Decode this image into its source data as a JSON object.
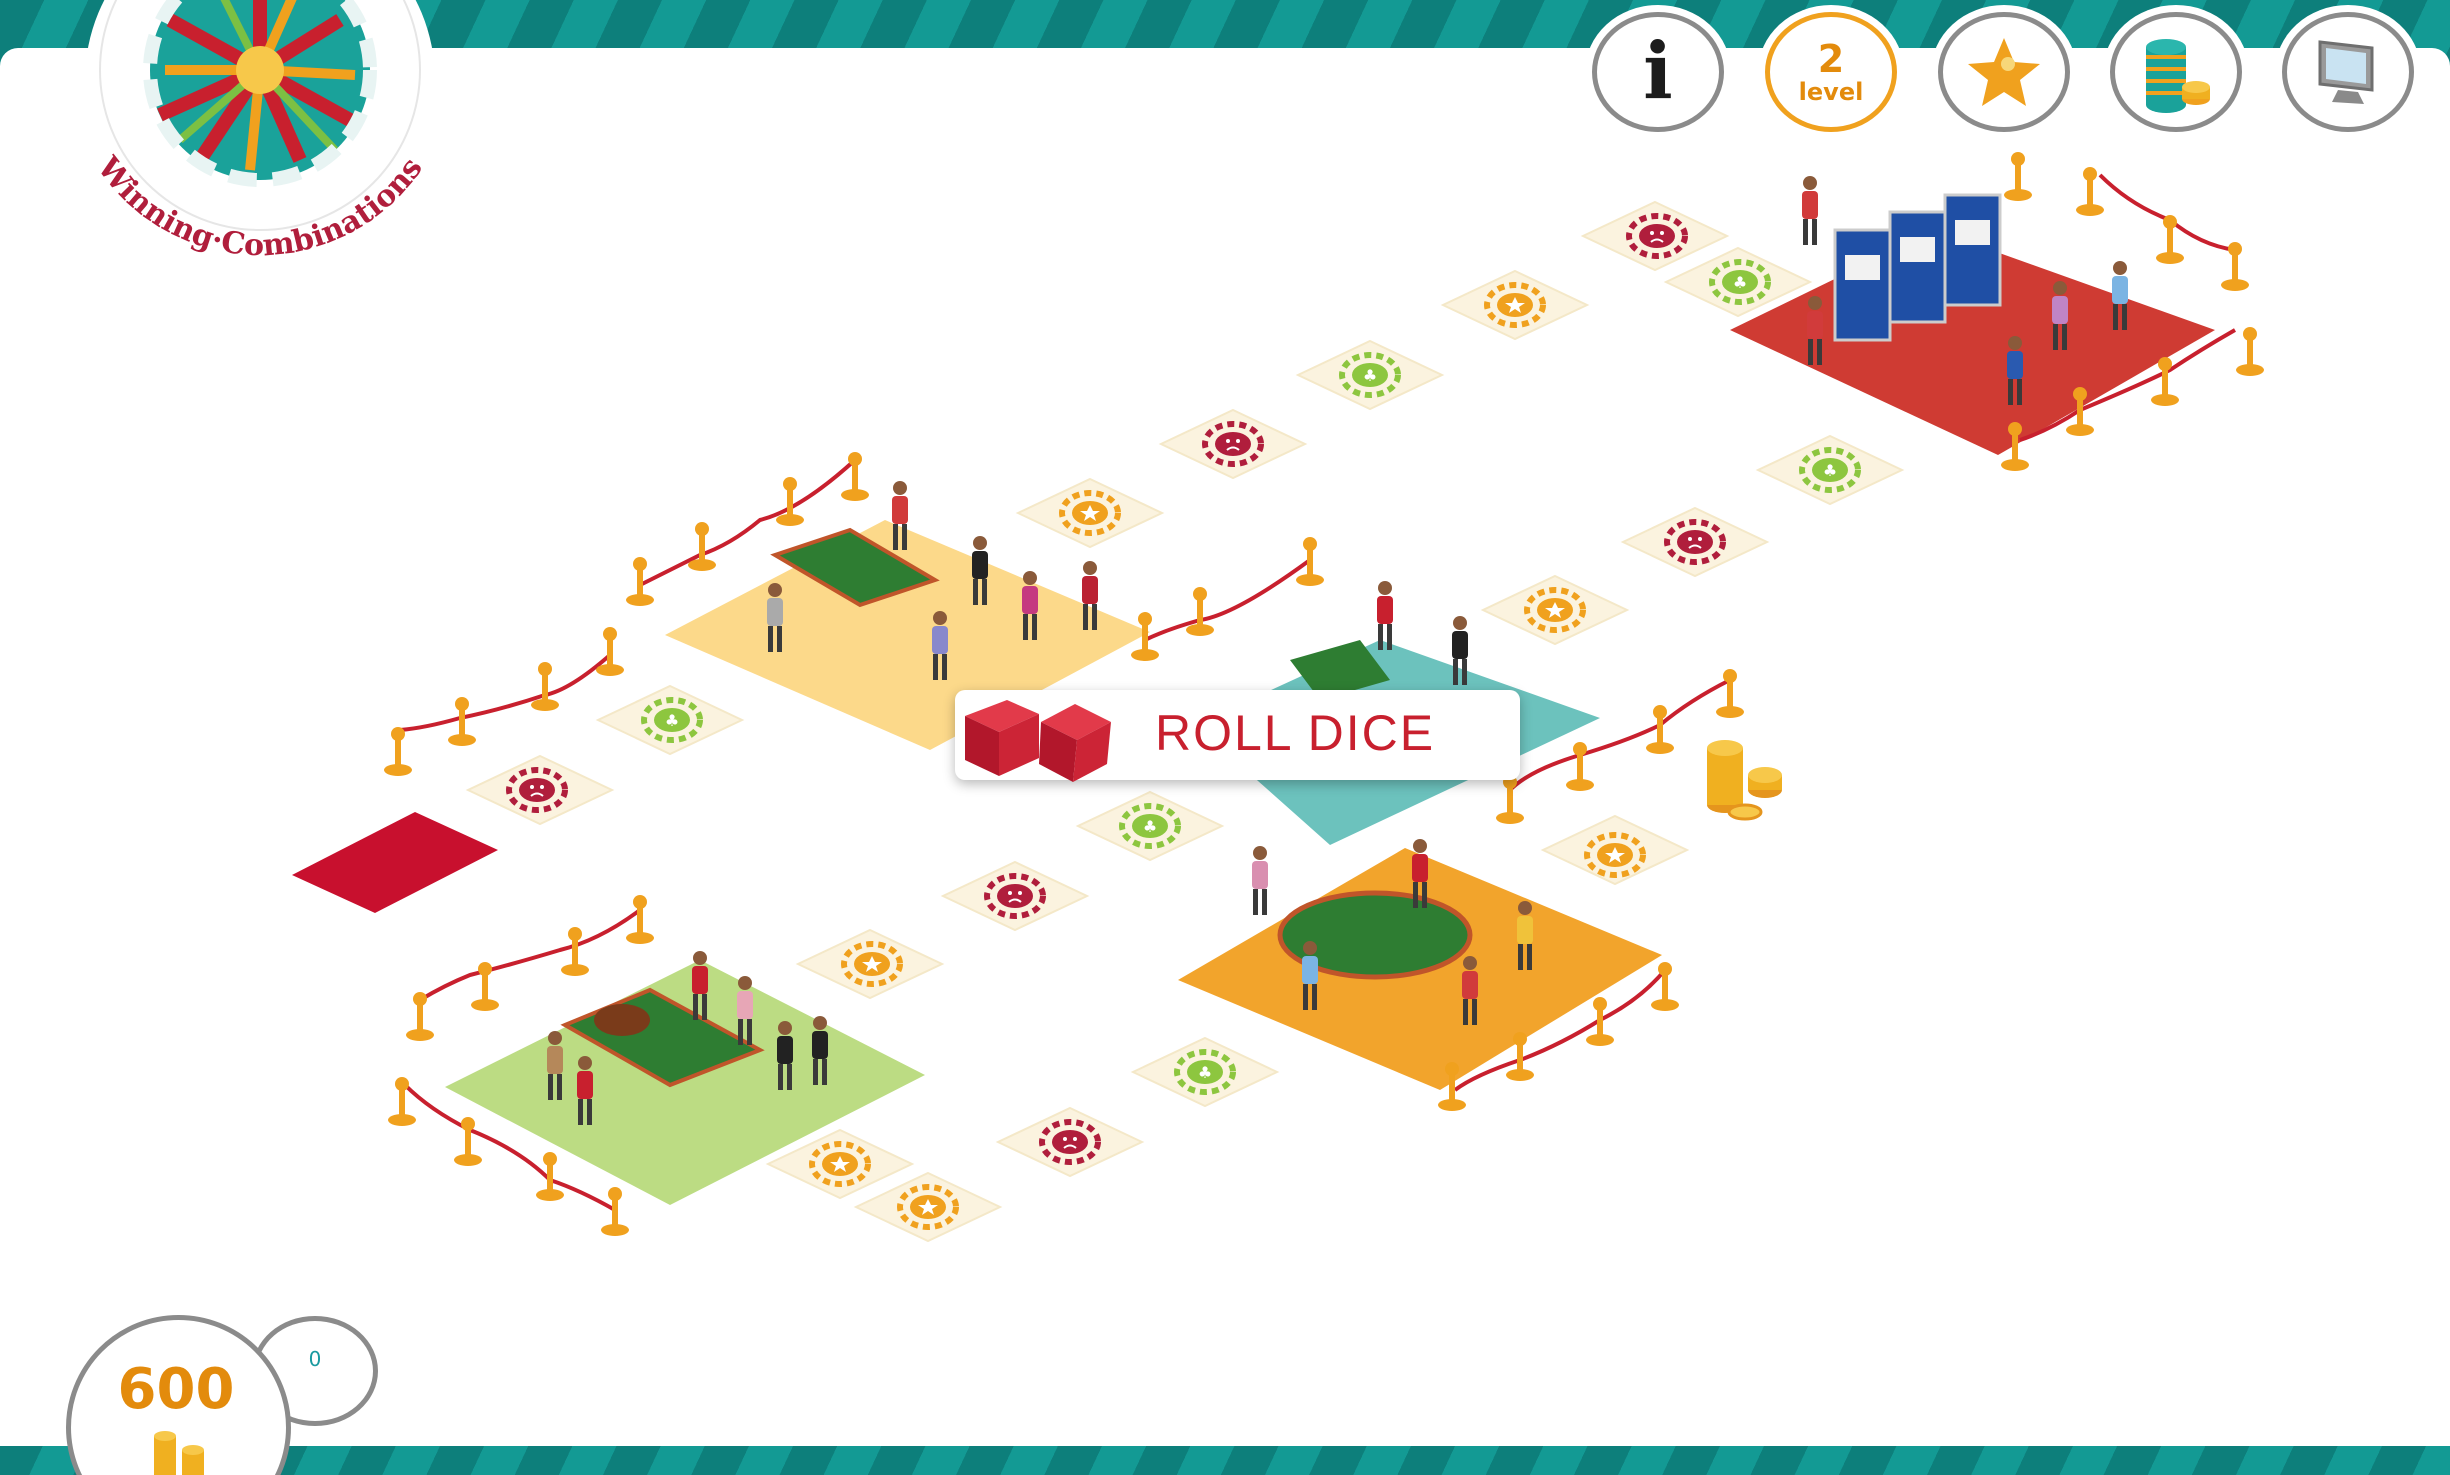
{
  "game": {
    "title": "Winning·Combinations",
    "level": {
      "number": "2",
      "label": "level"
    },
    "balance": "600",
    "bet": "0",
    "roll_dice_label": "ROLL DICE"
  },
  "toolbar": {
    "buttons": [
      {
        "name": "info",
        "icon": "info-icon"
      },
      {
        "name": "level",
        "icon": "level-badge"
      },
      {
        "name": "favorites",
        "icon": "star-icon"
      },
      {
        "name": "chips",
        "icon": "chip-stack-icon"
      },
      {
        "name": "display",
        "icon": "monitor-icon"
      }
    ]
  },
  "board": {
    "zones": [
      {
        "name": "roulette-zone",
        "color": "#fcd98a"
      },
      {
        "name": "blackjack-zone",
        "color": "#6cc2bd"
      },
      {
        "name": "slots-zone",
        "color": "#cf3b33"
      },
      {
        "name": "roulette-zone-2",
        "color": "#bcdc83"
      },
      {
        "name": "poker-zone",
        "color": "#f2a42c"
      },
      {
        "name": "start-tile",
        "color": "#c8102e"
      }
    ],
    "tile_types": [
      "star-chip",
      "green-chip",
      "sad-face-chip"
    ]
  },
  "colors": {
    "teal": "#108a86",
    "accent_red": "#c8202e",
    "gold": "#f0a11e",
    "rope": "#c8202e",
    "tile": "#fbf3df"
  }
}
